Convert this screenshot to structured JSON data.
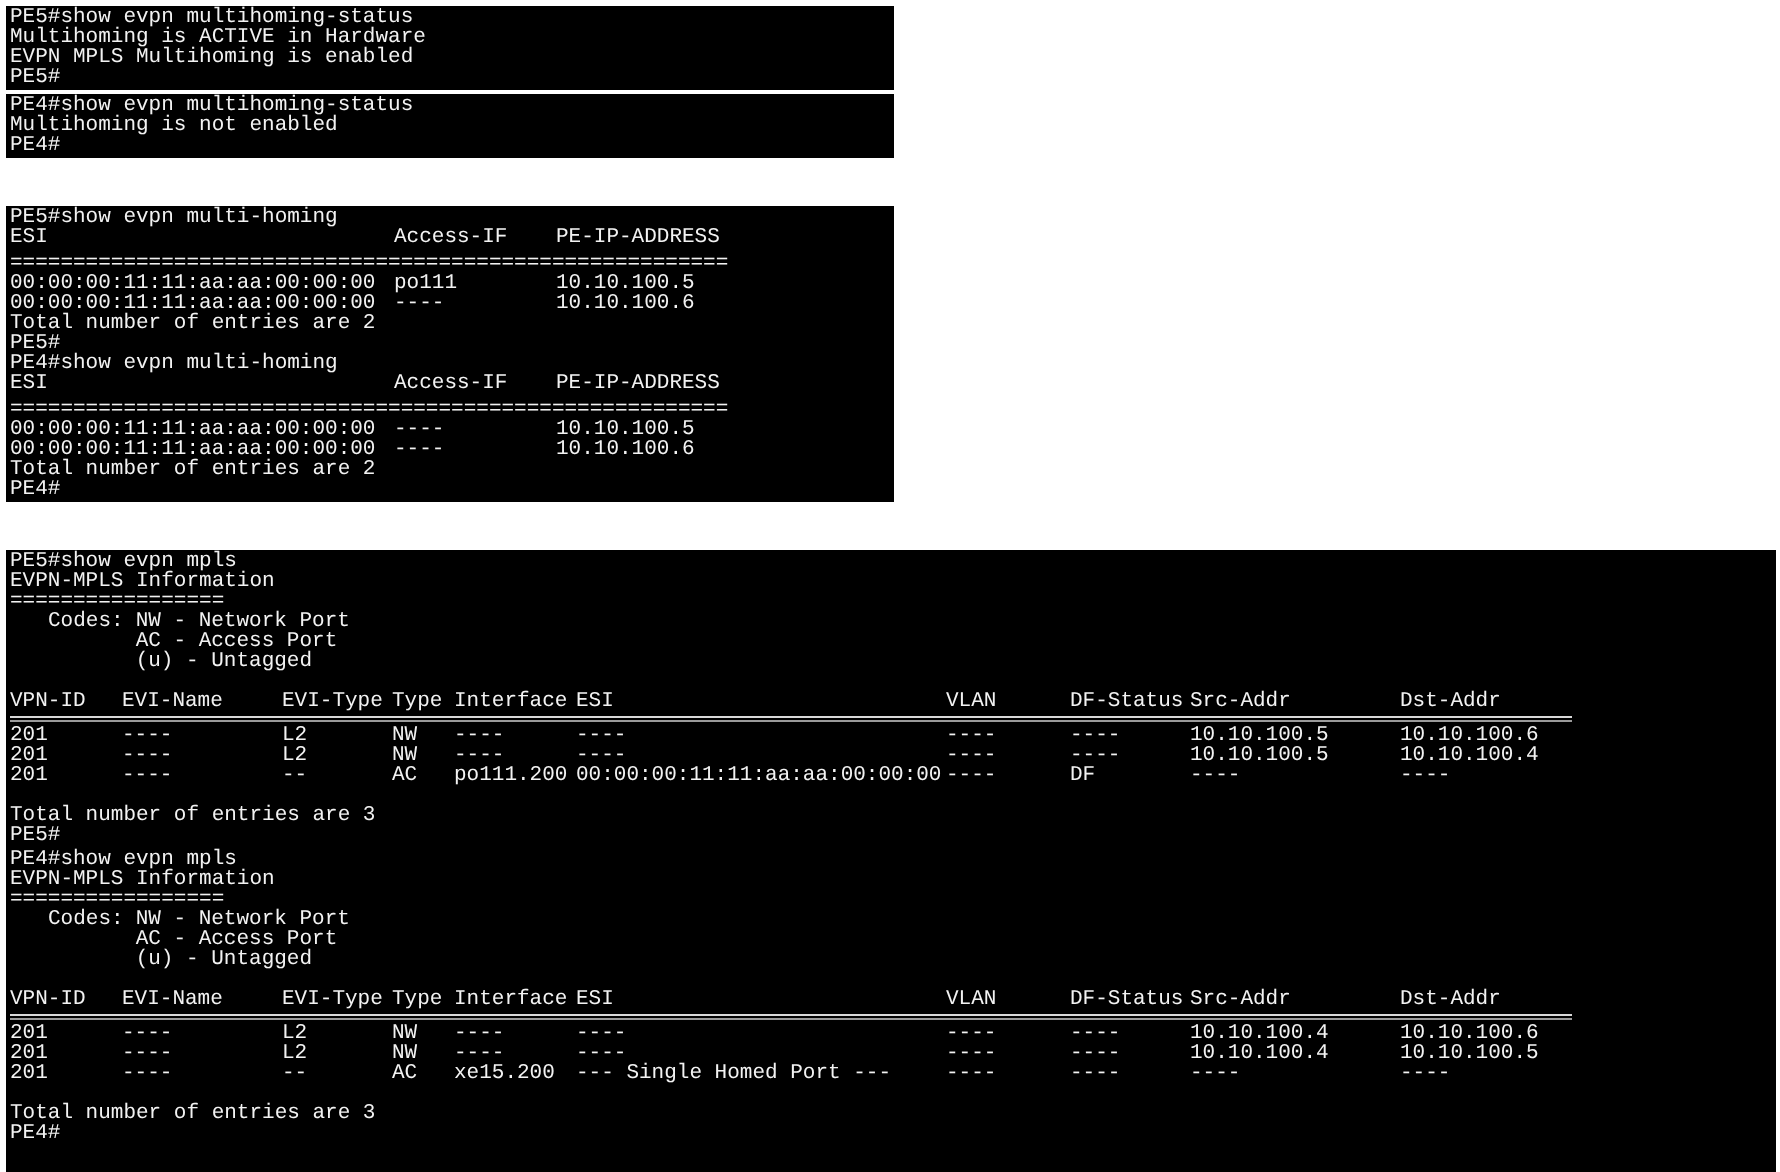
{
  "panels": [
    {
      "kind": "lines",
      "lines": [
        "PE5#show evpn multihoming-status",
        "Multihoming is ACTIVE in Hardware",
        "EVPN MPLS Multihoming is enabled",
        "PE5#"
      ]
    },
    {
      "kind": "lines",
      "lines": [
        "PE4#show evpn multihoming-status",
        "Multihoming is not enabled",
        "PE4#"
      ]
    },
    {
      "kind": "multihoming",
      "sections": [
        {
          "command": "PE5#show evpn multi-homing",
          "columns": [
            "ESI",
            "Access-IF",
            "PE-IP-ADDRESS"
          ],
          "separator": "=========================================================",
          "rows": [
            [
              "00:00:00:11:11:aa:aa:00:00:00",
              "po111",
              "10.10.100.5"
            ],
            [
              "00:00:00:11:11:aa:aa:00:00:00",
              "----",
              "10.10.100.6"
            ]
          ],
          "total": "Total number of entries are 2",
          "prompt": "PE5#"
        },
        {
          "command": "PE4#show evpn multi-homing",
          "columns": [
            "ESI",
            "Access-IF",
            "PE-IP-ADDRESS"
          ],
          "separator": "=========================================================",
          "rows": [
            [
              "00:00:00:11:11:aa:aa:00:00:00",
              "----",
              "10.10.100.5"
            ],
            [
              "00:00:00:11:11:aa:aa:00:00:00",
              "----",
              "10.10.100.6"
            ]
          ],
          "total": "Total number of entries are 2",
          "prompt": "PE4#"
        }
      ]
    },
    {
      "kind": "mpls",
      "sections": [
        {
          "command": "PE5#show evpn mpls",
          "title": "EVPN-MPLS Information",
          "separator": "=================",
          "codes_label": "Codes:",
          "codes": [
            "NW - Network Port",
            "AC - Access Port",
            "(u) - Untagged"
          ],
          "columns": [
            "VPN-ID",
            "EVI-Name",
            "EVI-Type",
            "Type",
            "Interface",
            "ESI",
            "VLAN",
            "DF-Status",
            "Src-Addr",
            "Dst-Addr"
          ],
          "rows": [
            [
              "201",
              "----",
              "L2",
              "NW",
              "----",
              "----",
              "----",
              "----",
              "10.10.100.5",
              "10.10.100.6"
            ],
            [
              "201",
              "----",
              "L2",
              "NW",
              "----",
              "----",
              "----",
              "----",
              "10.10.100.5",
              "10.10.100.4"
            ],
            [
              "201",
              "----",
              "--",
              "AC",
              "po111.200",
              "00:00:00:11:11:aa:aa:00:00:00",
              "----",
              "DF",
              "----",
              "----"
            ]
          ],
          "total": "Total number of entries are 3",
          "prompt": "PE5#"
        },
        {
          "command": "PE4#show evpn mpls",
          "title": "EVPN-MPLS Information",
          "separator": "=================",
          "codes_label": "Codes:",
          "codes": [
            "NW - Network Port",
            "AC - Access Port",
            "(u) - Untagged"
          ],
          "columns": [
            "VPN-ID",
            "EVI-Name",
            "EVI-Type",
            "Type",
            "Interface",
            "ESI",
            "VLAN",
            "DF-Status",
            "Src-Addr",
            "Dst-Addr"
          ],
          "rows": [
            [
              "201",
              "----",
              "L2",
              "NW",
              "----",
              "----",
              "----",
              "----",
              "10.10.100.4",
              "10.10.100.6"
            ],
            [
              "201",
              "----",
              "L2",
              "NW",
              "----",
              "----",
              "----",
              "----",
              "10.10.100.4",
              "10.10.100.5"
            ],
            [
              "201",
              "----",
              "--",
              "AC",
              "xe15.200",
              "--- Single Homed Port ---",
              "----",
              "----",
              "----",
              "----"
            ]
          ],
          "total": "Total number of entries are 3",
          "prompt": "PE4#"
        }
      ]
    }
  ]
}
